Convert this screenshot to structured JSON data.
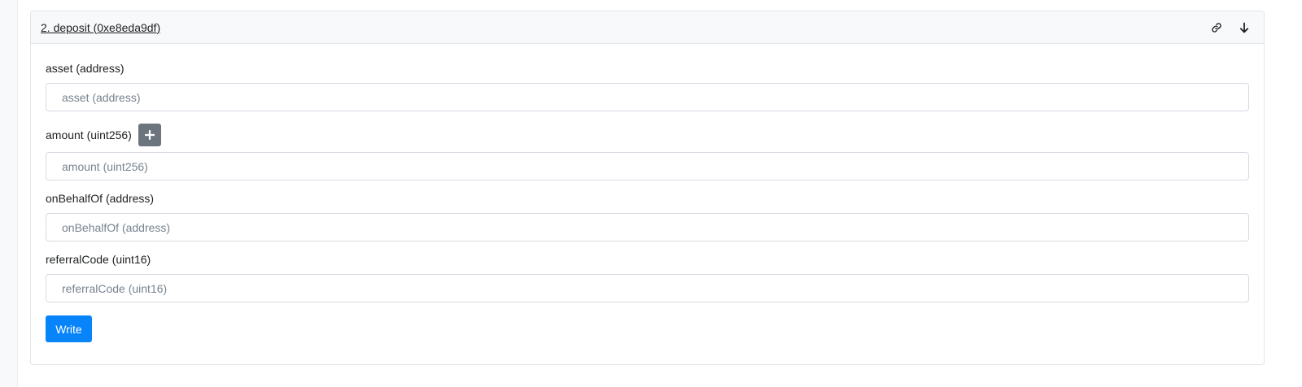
{
  "card": {
    "title": "2. deposit (0xe8eda9df)",
    "icons": {
      "link": "link-icon",
      "collapse": "arrow-down-icon"
    }
  },
  "fields": [
    {
      "label": "asset (address)",
      "placeholder": "asset (address)",
      "value": ""
    },
    {
      "label": "amount (uint256)",
      "placeholder": "amount (uint256)",
      "value": "",
      "has_plus_button": true
    },
    {
      "label": "onBehalfOf (address)",
      "placeholder": "onBehalfOf (address)",
      "value": ""
    },
    {
      "label": "referralCode (uint16)",
      "placeholder": "referralCode (uint16)",
      "value": ""
    }
  ],
  "write_button": {
    "label": "Write"
  },
  "colors": {
    "primary": "#0784fa",
    "secondary": "#6c757d",
    "header_bg": "#f8f9fa",
    "border": "#e1e4e8"
  }
}
